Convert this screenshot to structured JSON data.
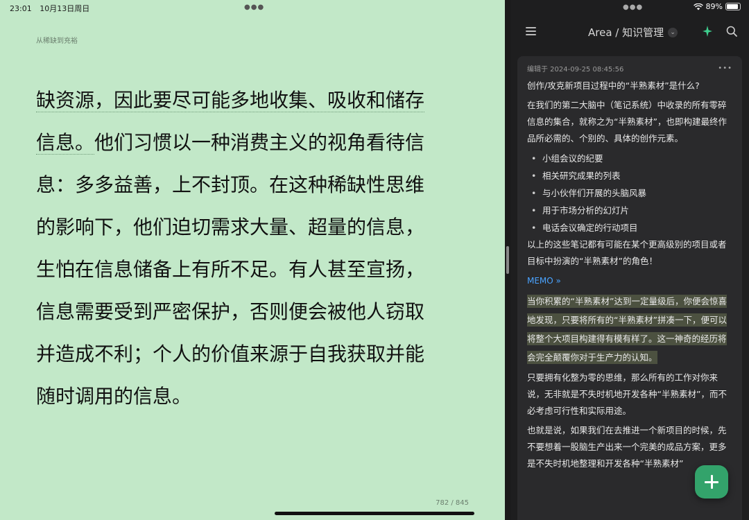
{
  "status_bar": {
    "time": "23:01",
    "date": "10月13日周日",
    "battery": "89%",
    "battery_level": 0.89
  },
  "reader": {
    "book_title": "从稀缺到充裕",
    "lines": [
      "缺资源，因此要尽可能多地收集、吸收和储存",
      "信息。他们习惯以一种消费主义的视角看待信",
      "息：多多益善，上不封顶。在这种稀缺性思维",
      "的影响下，他们迫切需求大量、超量的信息，",
      "生怕在信息储备上有所不足。有人甚至宣扬，",
      "信息需要受到严密保护，否则便会被他人窃取",
      "并造成不利；个人的价值来源于自我获取并能",
      "随时调用的信息。"
    ],
    "page_indicator": "782 / 845"
  },
  "notes": {
    "breadcrumb": "Area / 知识管理",
    "card": {
      "edited": "编辑于 2024-09-25 08:45:56",
      "question": "创作/攻克新项目过程中的“半熟素材”是什么?",
      "intro": "在我们的第二大脑中（笔记系统）中收录的所有零碎信息的集合，就称之为“半熟素材”，也即构建最终作品所必需的、个别的、具体的创作元素。",
      "bullets": [
        "小组会议的纪要",
        "相关研究成果的列表",
        "与小伙伴们开展的头脑风暴",
        "用于市场分析的幻灯片",
        "电话会议确定的行动项目"
      ],
      "summary": "以上的这些笔记都有可能在某个更高级别的项目或者目标中扮演的“半熟素材”的角色！",
      "memo_label": "MEMO »",
      "highlight": "当你积累的“半熟素材”达到一定量级后，你便会惊喜地发现，只要将所有的“半熟素材”拼凑一下，便可以将整个大项目构建得有模有样了。这一神奇的经历将会完全颠覆你对于生产力的认知。",
      "para2": "只要拥有化整为零的思维，那么所有的工作对你来说，无非就是不失时机地开发各种“半熟素材”，而不必考虑可行性和实际用途。",
      "para3": "也就是说，如果我们在去推进一个新项目的时候，先不要想着一股脑生产出来一个完美的成品方案，更多是不失时机地整理和开发各种“半熟素材”"
    }
  },
  "colors": {
    "reader_bg": "#c2e8c8",
    "notes_bg": "#1e1e1f",
    "card_bg": "#2a2a2c",
    "accent_green": "#33a36b",
    "memo_blue": "#4aa3ff",
    "highlight": "#4c5140"
  }
}
